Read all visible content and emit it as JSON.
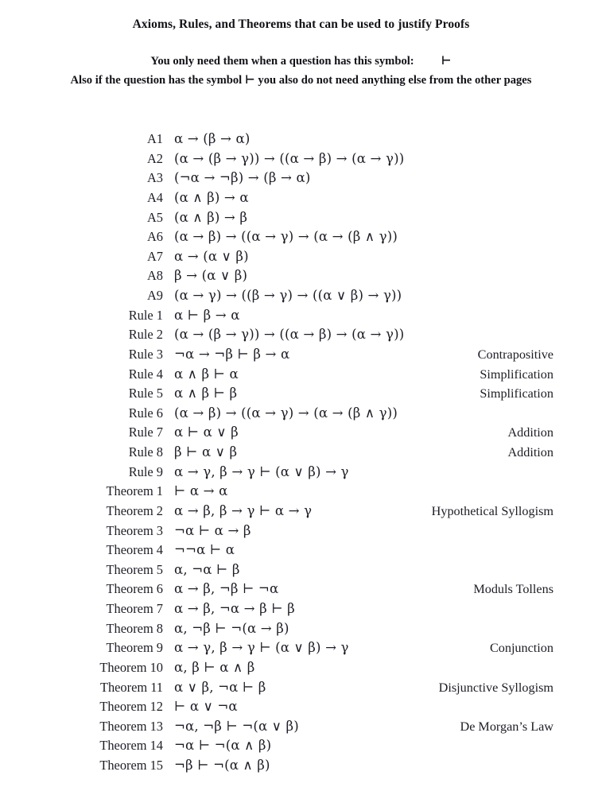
{
  "header": {
    "title": "Axioms, Rules, and Theorems that can be used to justify Proofs",
    "subtitle_1_text": "You only need them when a question has this symbol:",
    "subtitle_1_symbol": "⊢",
    "subtitle_2": "Also if the question has the symbol ⊢ you also do not need anything else from the other pages"
  },
  "symbols": {
    "turnstile": "⊢",
    "implies": "→",
    "and": "∧",
    "or": "∨",
    "not": "¬",
    "alpha": "α",
    "beta": "β",
    "gamma": "γ"
  },
  "colors": {
    "text": "#1d1d26",
    "heading": "#121218",
    "background": "#ffffff"
  },
  "entries": [
    {
      "label": "A1",
      "formula": "α → (β → α)",
      "note": ""
    },
    {
      "label": "A2",
      "formula": "(α → (β → γ)) → ((α → β) → (α → γ))",
      "note": ""
    },
    {
      "label": "A3",
      "formula": "(¬α → ¬β) → (β → α)",
      "note": ""
    },
    {
      "label": "A4",
      "formula": "(α ∧ β) → α",
      "note": ""
    },
    {
      "label": "A5",
      "formula": "(α ∧ β) → β",
      "note": ""
    },
    {
      "label": "A6",
      "formula": "(α → β) → ((α → γ) → (α → (β ∧ γ))",
      "note": ""
    },
    {
      "label": "A7",
      "formula": "α → (α ∨ β)",
      "note": ""
    },
    {
      "label": "A8",
      "formula": "β → (α ∨ β)",
      "note": ""
    },
    {
      "label": "A9",
      "formula": "(α → γ) → ((β → γ) → ((α ∨ β) → γ))",
      "note": ""
    },
    {
      "label": "Rule 1",
      "formula": "α ⊢ β → α",
      "note": ""
    },
    {
      "label": "Rule 2",
      "formula": "(α → (β → γ)) → ((α → β) → (α → γ))",
      "note": ""
    },
    {
      "label": "Rule 3",
      "formula": "¬α → ¬β ⊢ β → α",
      "note": "Contrapositive"
    },
    {
      "label": "Rule 4",
      "formula": "α ∧ β ⊢ α",
      "note": "Simplification"
    },
    {
      "label": "Rule 5",
      "formula": "α ∧ β ⊢ β",
      "note": "Simplification"
    },
    {
      "label": "Rule 6",
      "formula": "(α → β) → ((α → γ) → (α → (β ∧ γ))",
      "note": ""
    },
    {
      "label": "Rule 7",
      "formula": "α ⊢ α ∨ β",
      "note": "Addition"
    },
    {
      "label": "Rule 8",
      "formula": "β ⊢ α ∨ β",
      "note": "Addition"
    },
    {
      "label": "Rule 9",
      "formula": "α → γ, β → γ ⊢ (α ∨ β) → γ",
      "note": ""
    },
    {
      "label": "Theorem 1",
      "formula": "⊢ α → α",
      "note": ""
    },
    {
      "label": "Theorem 2",
      "formula": "α → β, β → γ ⊢ α → γ",
      "note": "Hypothetical Syllogism"
    },
    {
      "label": "Theorem 3",
      "formula": "¬α ⊢ α → β",
      "note": ""
    },
    {
      "label": "Theorem 4",
      "formula": "¬¬α ⊢ α",
      "note": ""
    },
    {
      "label": "Theorem 5",
      "formula": "α, ¬α ⊢ β",
      "note": ""
    },
    {
      "label": "Theorem 6",
      "formula": "α → β, ¬β ⊢ ¬α",
      "note": "Moduls Tollens"
    },
    {
      "label": "Theorem 7",
      "formula": "α → β, ¬α → β ⊢ β",
      "note": ""
    },
    {
      "label": "Theorem 8",
      "formula": "α, ¬β ⊢ ¬(α → β)",
      "note": ""
    },
    {
      "label": "Theorem 9",
      "formula": "α → γ, β → γ ⊢ (α ∨ β) → γ",
      "note": "Conjunction"
    },
    {
      "label": "Theorem 10",
      "formula": "α, β ⊢ α ∧ β",
      "note": ""
    },
    {
      "label": "Theorem 11",
      "formula": "α ∨ β, ¬α ⊢ β",
      "note": "Disjunctive Syllogism"
    },
    {
      "label": "Theorem 12",
      "formula": "⊢ α ∨ ¬α",
      "note": ""
    },
    {
      "label": "Theorem 13",
      "formula": "¬α, ¬β ⊢ ¬(α ∨ β)",
      "note": "De Morgan’s Law"
    },
    {
      "label": "Theorem 14",
      "formula": "¬α ⊢ ¬(α ∧ β)",
      "note": ""
    },
    {
      "label": "Theorem 15",
      "formula": "¬β ⊢ ¬(α ∧ β)",
      "note": ""
    }
  ]
}
